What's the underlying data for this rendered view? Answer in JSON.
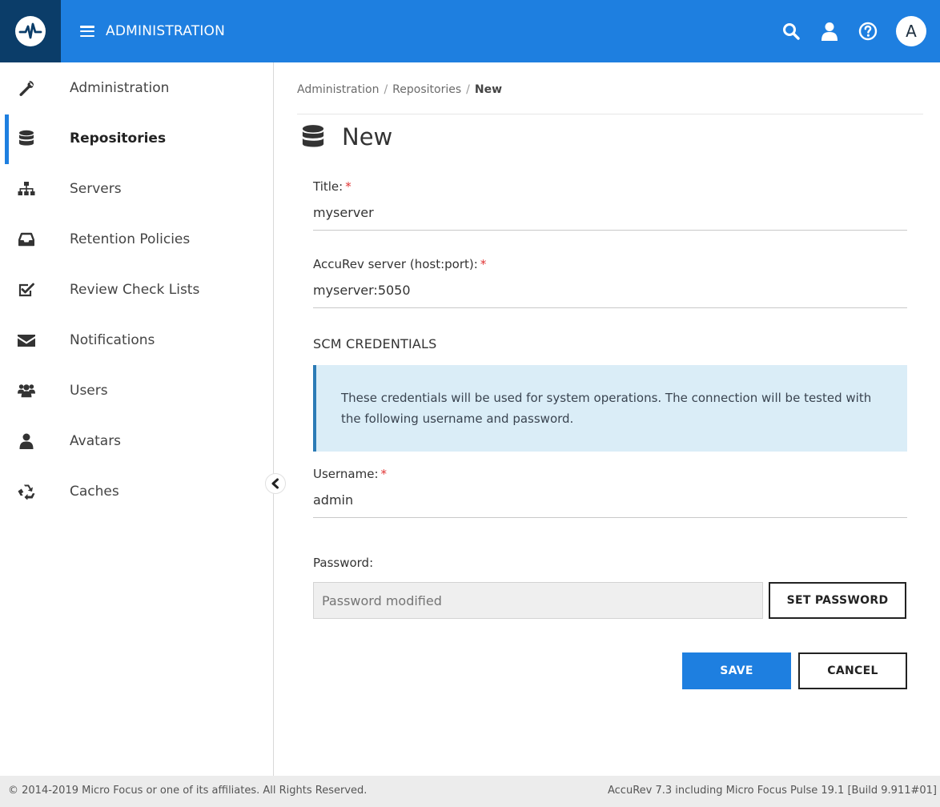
{
  "header": {
    "menu_label": "ADMINISTRATION",
    "avatar_initial": "A",
    "brand_color": "#1e7fe0",
    "logo_bg": "#0b3d69",
    "icons": [
      "search-icon",
      "user-icon",
      "help-icon"
    ]
  },
  "sidebar": {
    "active_index": 1,
    "items": [
      {
        "label": "Administration",
        "icon": "wrench-icon"
      },
      {
        "label": "Repositories",
        "icon": "database-icon"
      },
      {
        "label": "Servers",
        "icon": "sitemap-icon"
      },
      {
        "label": "Retention Policies",
        "icon": "inbox-icon"
      },
      {
        "label": "Review Check Lists",
        "icon": "checkbox-icon"
      },
      {
        "label": "Notifications",
        "icon": "envelope-icon"
      },
      {
        "label": "Users",
        "icon": "users-icon"
      },
      {
        "label": "Avatars",
        "icon": "user-icon"
      },
      {
        "label": "Caches",
        "icon": "recycle-icon"
      }
    ]
  },
  "breadcrumb": {
    "items": [
      "Administration",
      "Repositories"
    ],
    "separator": "/",
    "current": "New"
  },
  "page": {
    "title": "New"
  },
  "form": {
    "title_label": "Title:",
    "title_value": "myserver",
    "server_label": "AccuRev server (host:port):",
    "server_value": "myserver:5050",
    "required_mark": "*",
    "section_title": "SCM CREDENTIALS",
    "info_text": "These credentials will be used for system operations. The connection will be tested with the following username and password.",
    "username_label": "Username:",
    "username_value": "admin",
    "password_label": "Password:",
    "password_placeholder": "Password modified",
    "set_password_label": "SET PASSWORD",
    "save_label": "SAVE",
    "cancel_label": "CANCEL"
  },
  "footer": {
    "copyright": "© 2014-2019 Micro Focus or one of its affiliates. All Rights Reserved.",
    "version": "AccuRev 7.3 including Micro Focus Pulse 19.1 [Build 9.911#01]"
  }
}
